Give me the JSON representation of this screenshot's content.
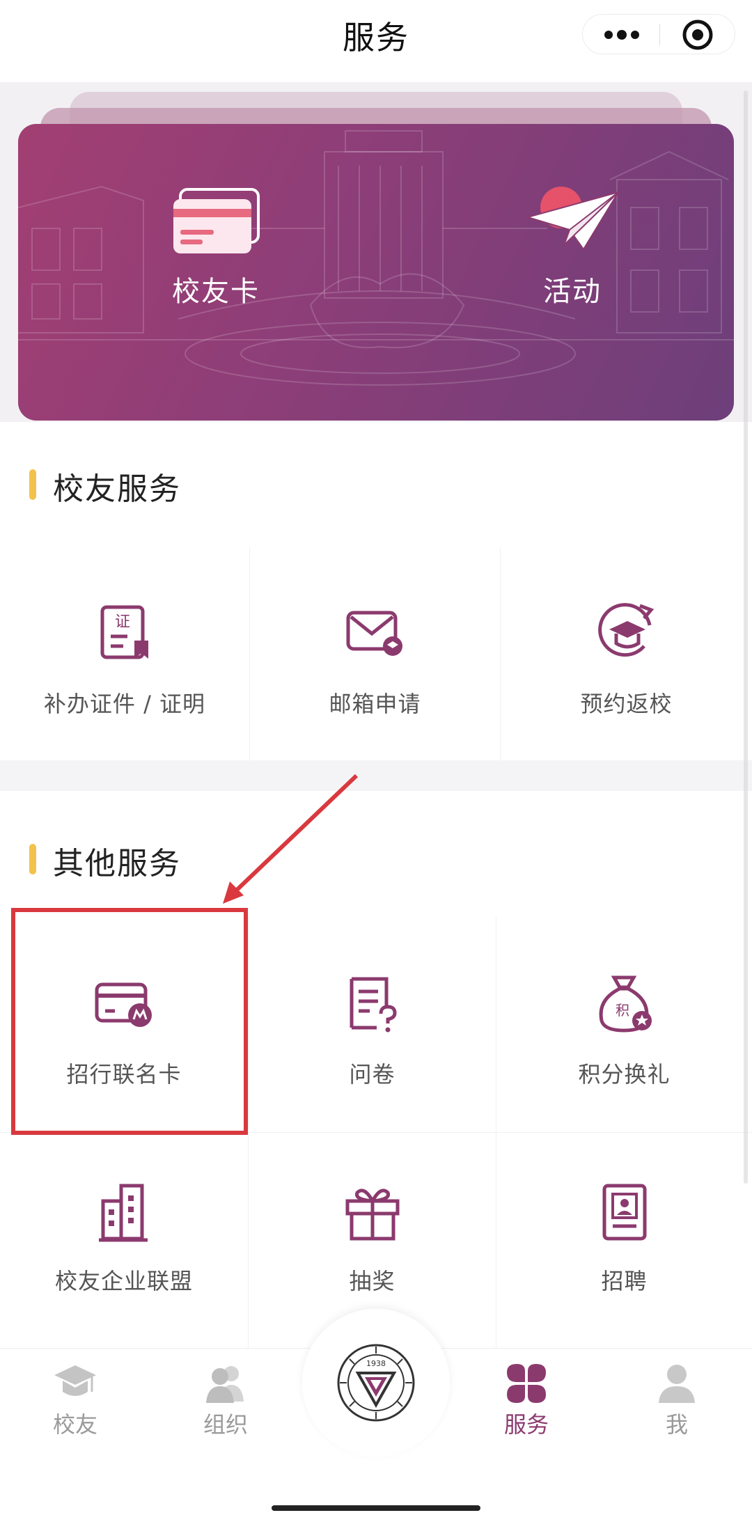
{
  "nav": {
    "title": "服务"
  },
  "banner": {
    "items": [
      {
        "label": "校友卡"
      },
      {
        "label": "活动"
      }
    ]
  },
  "alumni_services": {
    "title": "校友服务",
    "items": [
      {
        "label": "补办证件 / 证明",
        "icon": "certificate-icon"
      },
      {
        "label": "邮箱申请",
        "icon": "mail-icon"
      },
      {
        "label": "预约返校",
        "icon": "graduation-return-icon"
      }
    ]
  },
  "other_services": {
    "title": "其他服务",
    "items": [
      {
        "label": "招行联名卡",
        "icon": "bank-card-icon"
      },
      {
        "label": "问卷",
        "icon": "questionnaire-icon"
      },
      {
        "label": "积分换礼",
        "icon": "points-bag-icon"
      },
      {
        "label": "校友企业联盟",
        "icon": "building-icon"
      },
      {
        "label": "抽奖",
        "icon": "gift-icon"
      },
      {
        "label": "招聘",
        "icon": "resume-icon"
      }
    ]
  },
  "cert_badge": "证",
  "points_badge": "积",
  "logo": {
    "year": "1938"
  },
  "tabs": [
    {
      "label": "校友",
      "icon": "graduation-cap-icon"
    },
    {
      "label": "组织",
      "icon": "people-icon"
    },
    {
      "label": "服务",
      "icon": "clover-icon",
      "active": true
    },
    {
      "label": "我",
      "icon": "person-icon"
    }
  ],
  "colors": {
    "accent": "#8b3a6e",
    "highlight": "#d9393e",
    "section_bar": "#f3c24d"
  }
}
